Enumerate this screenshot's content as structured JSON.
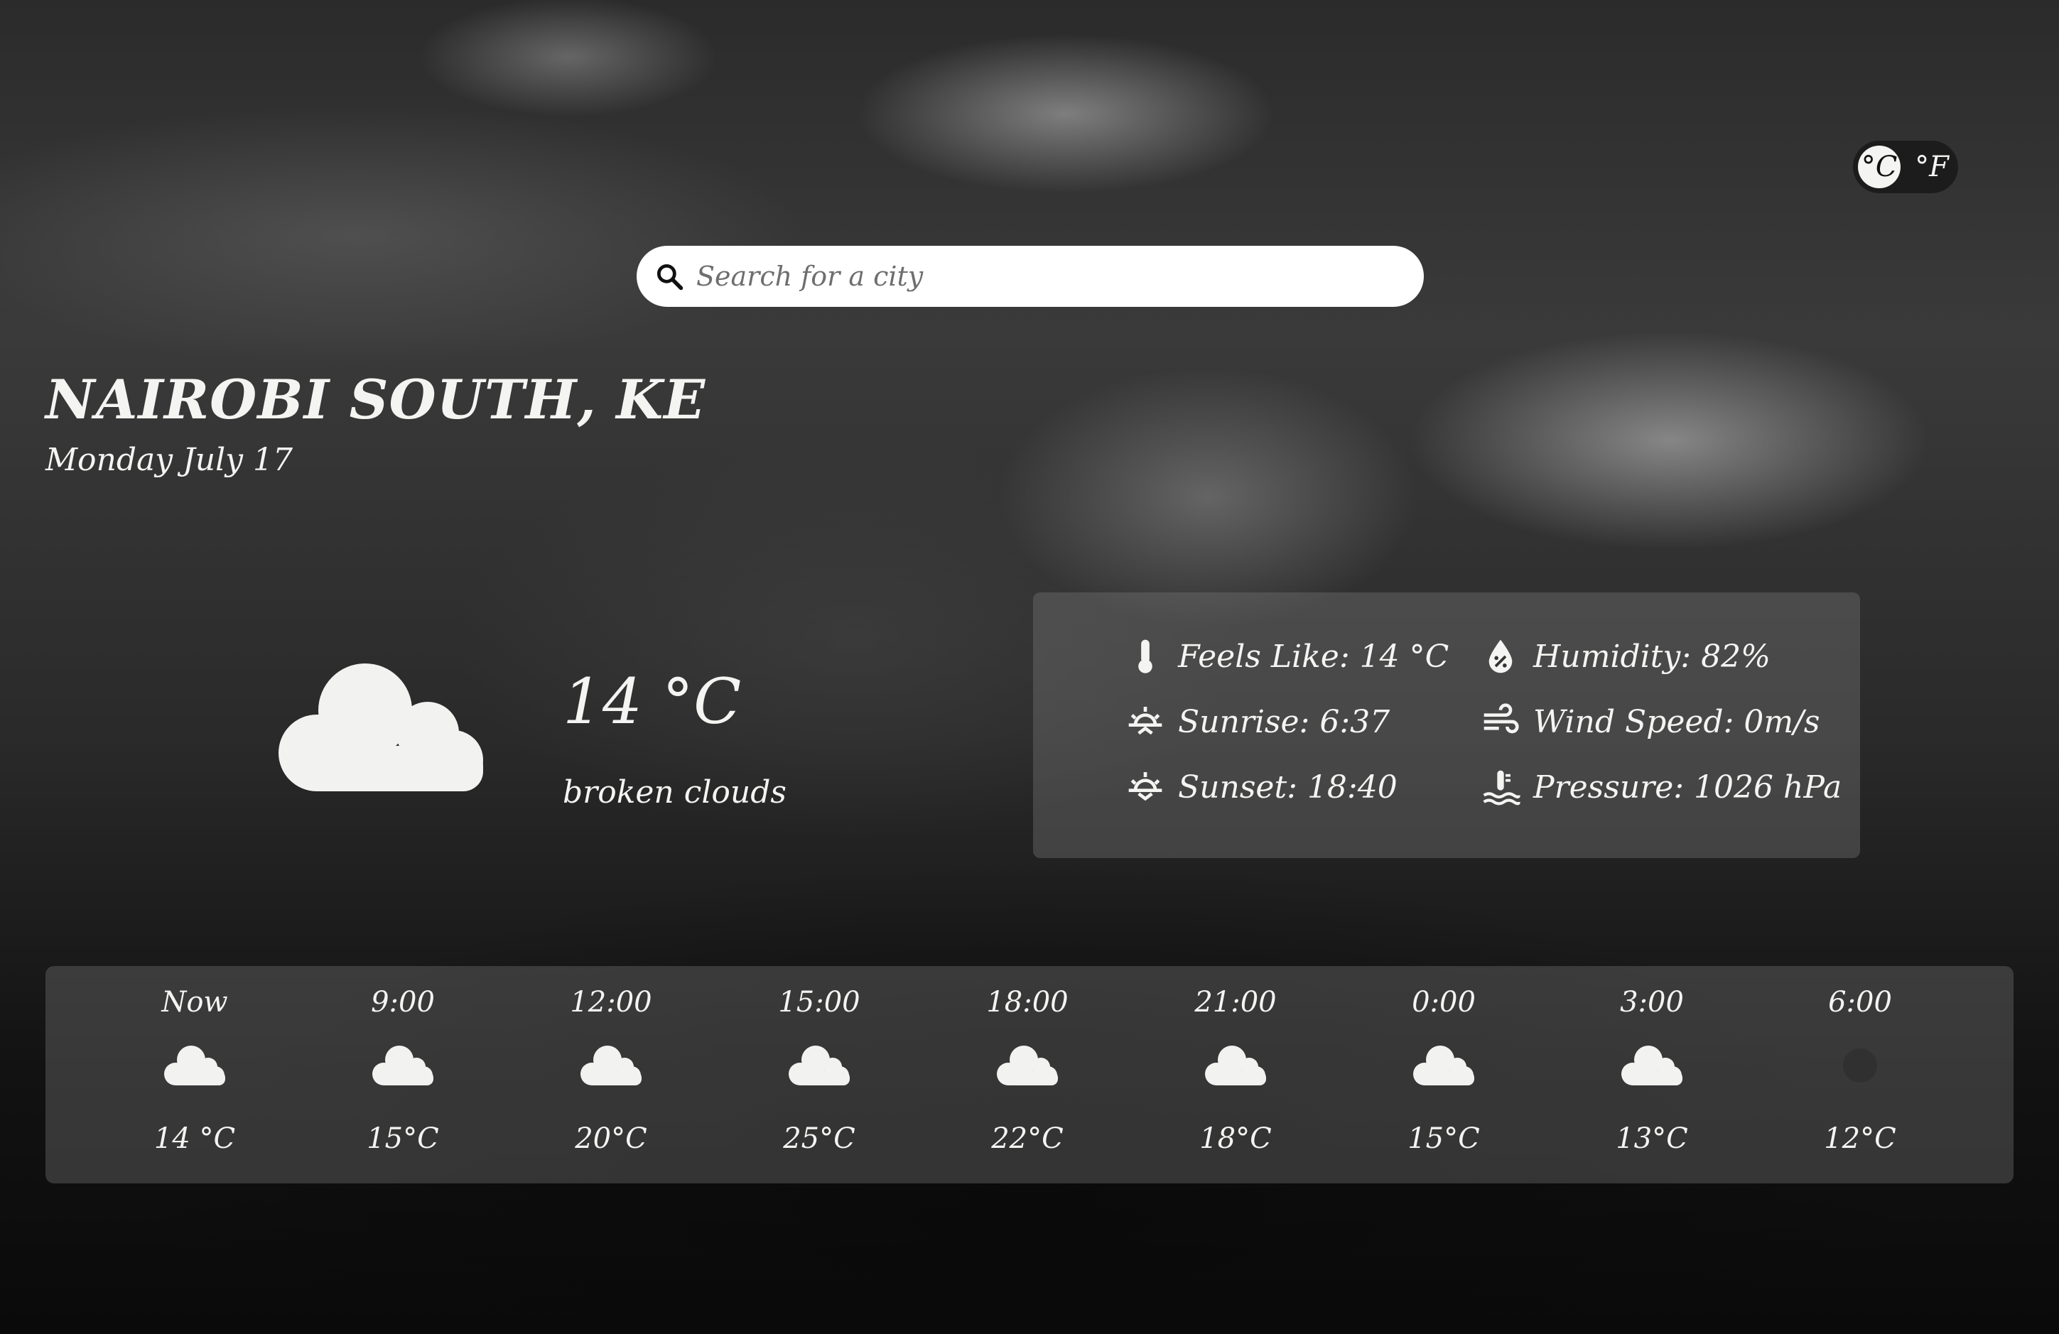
{
  "units": {
    "celsius": "°C",
    "fahrenheit": "°F"
  },
  "search": {
    "placeholder": "Search for a city",
    "value": ""
  },
  "location": {
    "city": "NAIROBI SOUTH, KE",
    "date": "Monday July 17"
  },
  "current": {
    "temperature": "14 °C",
    "description": "broken clouds",
    "icon": "cloud-icon"
  },
  "details": {
    "feels_like": "Feels Like: 14 °C",
    "sunrise": "Sunrise: 6:37",
    "sunset": "Sunset: 18:40",
    "humidity": "Humidity: 82%",
    "wind_speed": "Wind Speed: 0m/s",
    "pressure": "Pressure: 1026 hPa"
  },
  "forecast": [
    {
      "time": "Now",
      "temp": "14 °C",
      "icon": "cloud-icon"
    },
    {
      "time": "9:00",
      "temp": "15°C",
      "icon": "cloud-icon"
    },
    {
      "time": "12:00",
      "temp": "20°C",
      "icon": "cloud-icon"
    },
    {
      "time": "15:00",
      "temp": "25°C",
      "icon": "cloud-icon"
    },
    {
      "time": "18:00",
      "temp": "22°C",
      "icon": "cloud-icon"
    },
    {
      "time": "21:00",
      "temp": "18°C",
      "icon": "cloud-icon"
    },
    {
      "time": "0:00",
      "temp": "15°C",
      "icon": "cloud-icon"
    },
    {
      "time": "3:00",
      "temp": "13°C",
      "icon": "cloud-icon"
    },
    {
      "time": "6:00",
      "temp": "12°C",
      "icon": "night-icon"
    }
  ]
}
